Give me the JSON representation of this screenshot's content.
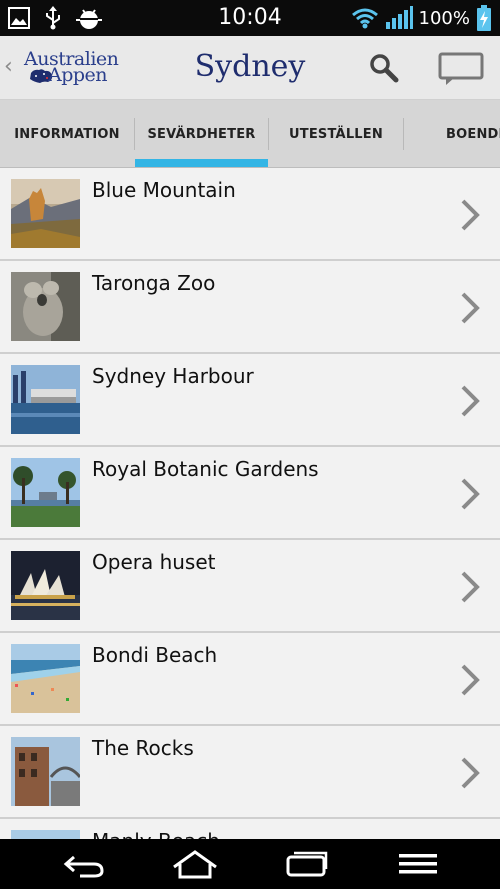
{
  "status_bar": {
    "time": "10:04",
    "battery": "100%",
    "icons": [
      "image-icon",
      "usb-icon",
      "android-debug-icon",
      "wifi-icon",
      "signal-icon",
      "battery-charging-icon"
    ]
  },
  "action_bar": {
    "logo_line1": "Australien",
    "logo_line2": "Appen",
    "title": "Sydney",
    "icons": [
      "back-chevron-icon",
      "search-icon",
      "chat-icon"
    ]
  },
  "tabs": [
    {
      "label": "INFORMATION",
      "selected": false
    },
    {
      "label": "SEVÄRDHETER",
      "selected": true
    },
    {
      "label": "UTESTÄLLEN",
      "selected": false
    },
    {
      "label": "BOENDE",
      "selected": false
    }
  ],
  "accent_color": "#33b5e5",
  "title_color": "#1f2d6e",
  "list": {
    "items": [
      {
        "label": "Blue Mountain"
      },
      {
        "label": "Taronga Zoo"
      },
      {
        "label": "Sydney Harbour"
      },
      {
        "label": "Royal Botanic Gardens"
      },
      {
        "label": "Opera huset"
      },
      {
        "label": "Bondi Beach"
      },
      {
        "label": "The Rocks"
      },
      {
        "label": "Manly Beach"
      }
    ]
  },
  "nav_bar": {
    "icons": [
      "back-icon",
      "home-icon",
      "recent-apps-icon",
      "menu-icon"
    ]
  }
}
